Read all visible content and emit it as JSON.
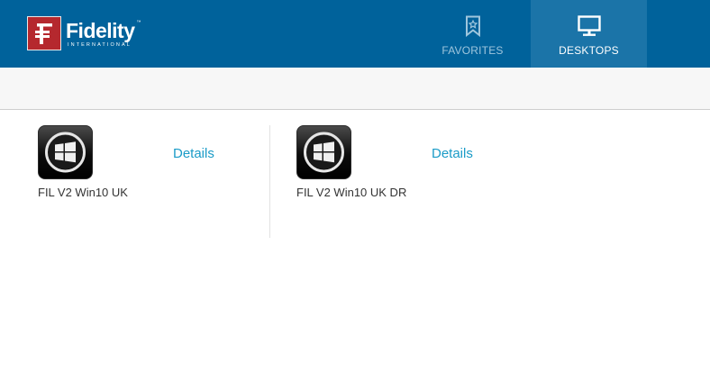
{
  "brand": {
    "name": "Fidelity",
    "subtitle": "INTERNATIONAL",
    "trademark": "™",
    "mark_color": "#b5282e"
  },
  "header": {
    "background": "#00629b",
    "tabs": [
      {
        "label": "FAVORITES",
        "icon": "bookmark-icon",
        "active": false
      },
      {
        "label": "DESKTOPS",
        "icon": "monitor-icon",
        "active": true
      }
    ]
  },
  "desktops": [
    {
      "name": "FIL V2 Win10 UK",
      "details_label": "Details",
      "icon": "windows-logo-icon"
    },
    {
      "name": "FIL V2 Win10 UK DR",
      "details_label": "Details",
      "icon": "windows-logo-icon"
    }
  ],
  "colors": {
    "accent_link": "#1a9bc7",
    "active_tab": "#1b74a8",
    "inactive_tab_text": "#9fc6dd"
  }
}
